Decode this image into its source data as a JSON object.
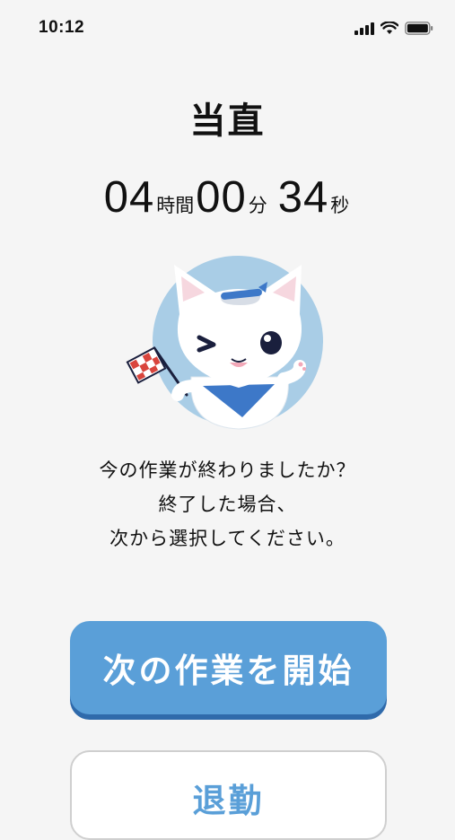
{
  "status_bar": {
    "time": "10:12",
    "icons": [
      "cellular-signal-icon",
      "wifi-icon",
      "battery-icon"
    ]
  },
  "page": {
    "title": "当直"
  },
  "timer": {
    "hours": "04",
    "hours_unit": "時間",
    "minutes": "00",
    "minutes_unit": "分",
    "seconds": "34",
    "seconds_unit": "秒"
  },
  "mascot": {
    "name": "cat-mascot-illustration"
  },
  "message": {
    "line1": "今の作業が終わりましたか？",
    "line2": "終了した場合、",
    "line3": "次から選択してください。"
  },
  "actions": {
    "primary_label": "次の作業を開始",
    "secondary_label": "退勤"
  },
  "colors": {
    "background": "#f5f5f5",
    "accent": "#5a9fd8",
    "accent_shadow": "#2f6aab",
    "mascot_circle": "#a9cde6"
  }
}
